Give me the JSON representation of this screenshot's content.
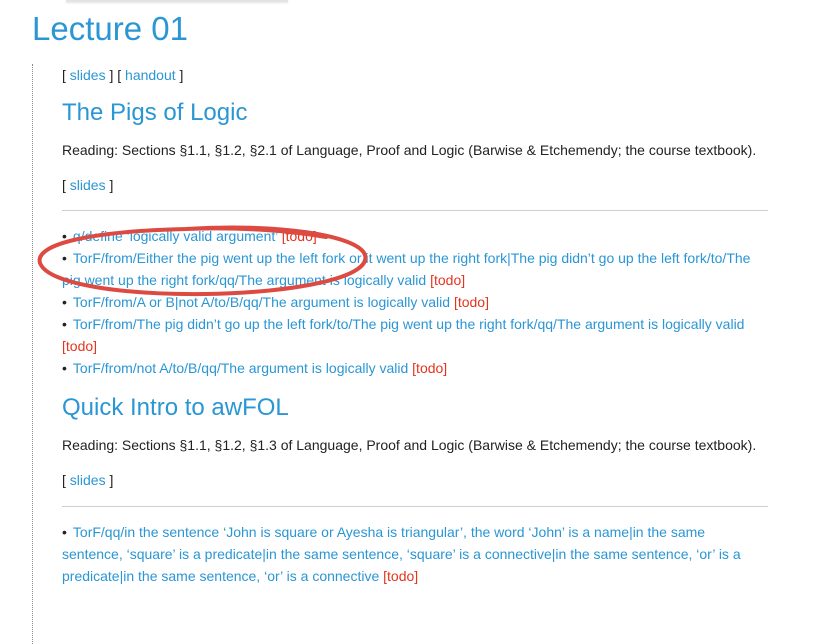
{
  "header": {
    "title": "Lecture 01"
  },
  "lecture_links": {
    "open1": "[",
    "slides": "slides",
    "mid": "] [",
    "handout": "handout",
    "close": "]"
  },
  "sections": [
    {
      "title": "The Pigs of Logic",
      "reading": "Reading: Sections §1.1, §1.2, §2.1 of Language, Proof and Logic (Barwise & Etchemendy; the course textbook).",
      "slides_open": "[",
      "slides": "slides",
      "slides_close": "]",
      "items": [
        {
          "text": "q/define ‘logically valid argument’",
          "tag": "[todo]"
        },
        {
          "text": "TorF/from/Either the pig went up the left fork or it went up the right fork|The pig didn’t go up the left fork/to/The pig went up the right fork/qq/The argument is logically valid",
          "tag": "[todo]"
        },
        {
          "text": "TorF/from/A or B|not A/to/B/qq/The argument is logically valid",
          "tag": "[todo]"
        },
        {
          "text": "TorF/from/The pig didn’t go up the left fork/to/The pig went up the right fork/qq/The argument is logically valid",
          "tag": "[todo]"
        },
        {
          "text": "TorF/from/not A/to/B/qq/The argument is logically valid",
          "tag": "[todo]"
        }
      ]
    },
    {
      "title": "Quick Intro to awFOL",
      "reading": "Reading: Sections §1.1, §1.2, §1.3 of Language, Proof and Logic (Barwise & Etchemendy; the course textbook).",
      "slides_open": "[",
      "slides": "slides",
      "slides_close": "]",
      "items": [
        {
          "text": "TorF/qq/in the sentence ‘John is square or Ayesha is triangular’, the word ‘John’ is a name|in the same sentence, ‘square’ is a predicate|in the same sentence, ‘square’ is a connective|in the same sentence, ‘or’ is a predicate|in the same sentence, ‘or’ is a connective",
          "tag": "[todo]"
        }
      ]
    }
  ],
  "colors": {
    "link": "#2a96d4",
    "todo": "#e3341f",
    "annotation": "#dc4a42"
  },
  "icons": {
    "annotation": "hand-drawn-ellipse"
  }
}
